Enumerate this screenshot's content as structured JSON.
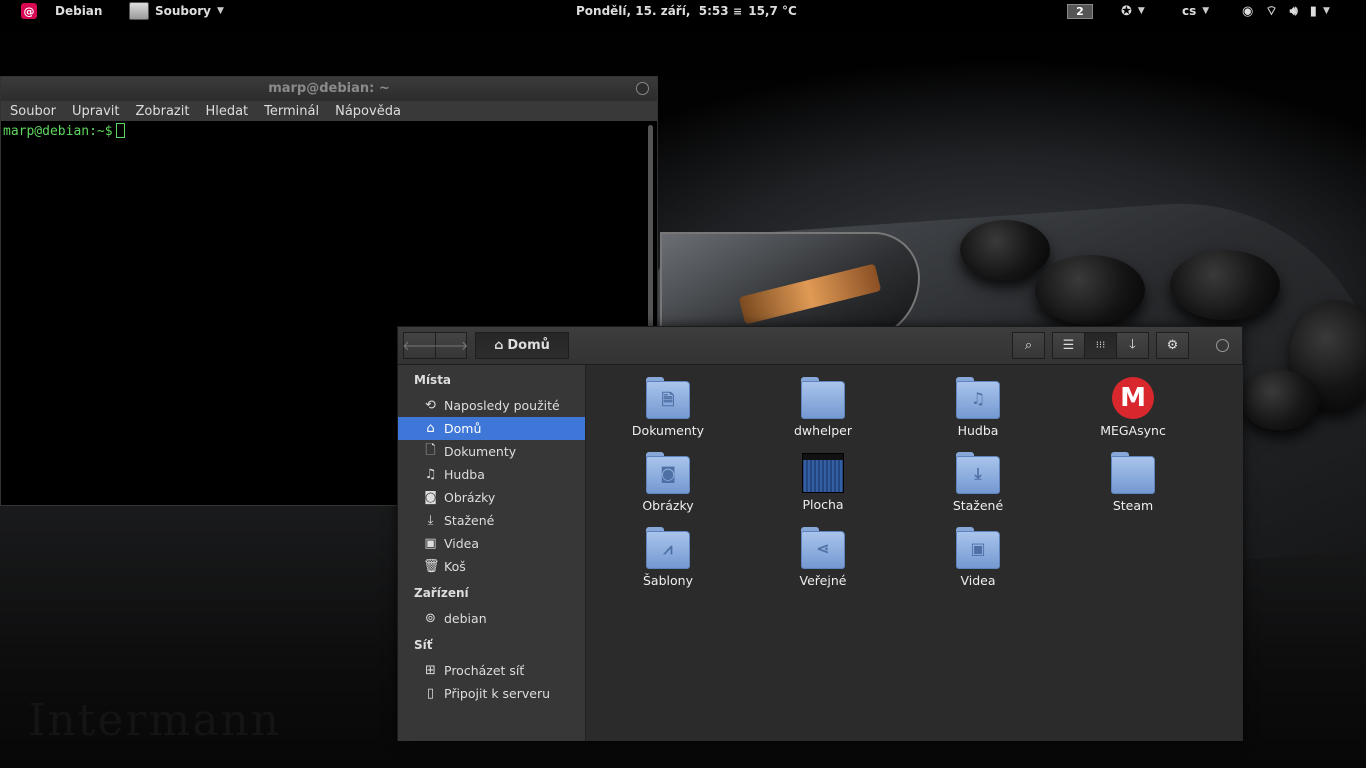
{
  "top_panel": {
    "activities_label": "Debian",
    "app_menu_label": "Soubory",
    "clock": "Pondělí, 15. září,  5:53",
    "weather": "15,7 °C",
    "workspace": "2",
    "language": "cs"
  },
  "terminal": {
    "title": "marp@debian: ~",
    "menu": [
      "Soubor",
      "Upravit",
      "Zobrazit",
      "Hledat",
      "Terminál",
      "Nápověda"
    ],
    "prompt": "marp@debian:~$"
  },
  "files": {
    "path_label": "Domů",
    "sidebar": {
      "places_heading": "Místa",
      "places": [
        {
          "label": "Naposledy použité",
          "icon": "recent-icon"
        },
        {
          "label": "Domů",
          "icon": "home-icon"
        },
        {
          "label": "Dokumenty",
          "icon": "document-icon"
        },
        {
          "label": "Hudba",
          "icon": "music-icon"
        },
        {
          "label": "Obrázky",
          "icon": "camera-icon"
        },
        {
          "label": "Stažené",
          "icon": "download-icon"
        },
        {
          "label": "Videa",
          "icon": "video-camera-icon"
        },
        {
          "label": "Koš",
          "icon": "trash-icon"
        }
      ],
      "devices_heading": "Zařízení",
      "devices": [
        {
          "label": "debian",
          "icon": "harddisk-icon"
        }
      ],
      "network_heading": "Síť",
      "network": [
        {
          "label": "Procházet síť",
          "icon": "network-icon"
        },
        {
          "label": "Připojit k serveru",
          "icon": "server-icon"
        }
      ]
    },
    "items": [
      {
        "label": "Dokumenty",
        "icon": "folder-documents-icon"
      },
      {
        "label": "dwhelper",
        "icon": "folder-icon"
      },
      {
        "label": "Hudba",
        "icon": "folder-music-icon"
      },
      {
        "label": "MEGAsync",
        "icon": "megasync-icon"
      },
      {
        "label": "Obrázky",
        "icon": "folder-pictures-icon"
      },
      {
        "label": "Plocha",
        "icon": "desktop-thumbnail-icon"
      },
      {
        "label": "Stažené",
        "icon": "folder-download-icon"
      },
      {
        "label": "Steam",
        "icon": "folder-icon"
      },
      {
        "label": "Šablony",
        "icon": "folder-templates-icon"
      },
      {
        "label": "Veřejné",
        "icon": "folder-publicshare-icon"
      },
      {
        "label": "Videa",
        "icon": "folder-videos-icon"
      }
    ]
  },
  "colors": {
    "selection": "#3f77d8",
    "terminal_text": "#5fd75f",
    "folder": "#a9c4ec",
    "mega": "#d9272e",
    "debian": "#d70751"
  }
}
